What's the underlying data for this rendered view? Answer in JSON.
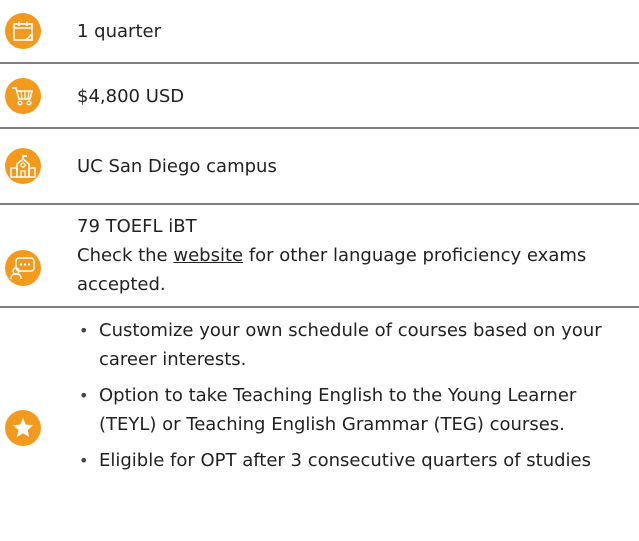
{
  "colors": {
    "accent": "#f39a1d",
    "divider": "#7f7f7f",
    "text": "#222222"
  },
  "duration": {
    "icon": "calendar-icon",
    "text": "1 quarter"
  },
  "cost": {
    "icon": "shopping-cart-icon",
    "text": "$4,800 USD"
  },
  "location": {
    "icon": "school-building-icon",
    "text": "UC San Diego campus"
  },
  "requirements": {
    "icon": "chat-bubble-icon",
    "line1": "79 TOEFL iBT",
    "prefix": "Check the ",
    "link_text": "website",
    "suffix": " for other language proficiency exams accepted."
  },
  "highlights": {
    "icon": "star-icon",
    "items": [
      "Customize your own schedule of courses based on your career interests.",
      "Option to take Teaching English to the Young Learner (TEYL) or Teaching English Grammar (TEG) courses.",
      "Eligible for OPT after 3 consecutive quarters of studies"
    ]
  }
}
